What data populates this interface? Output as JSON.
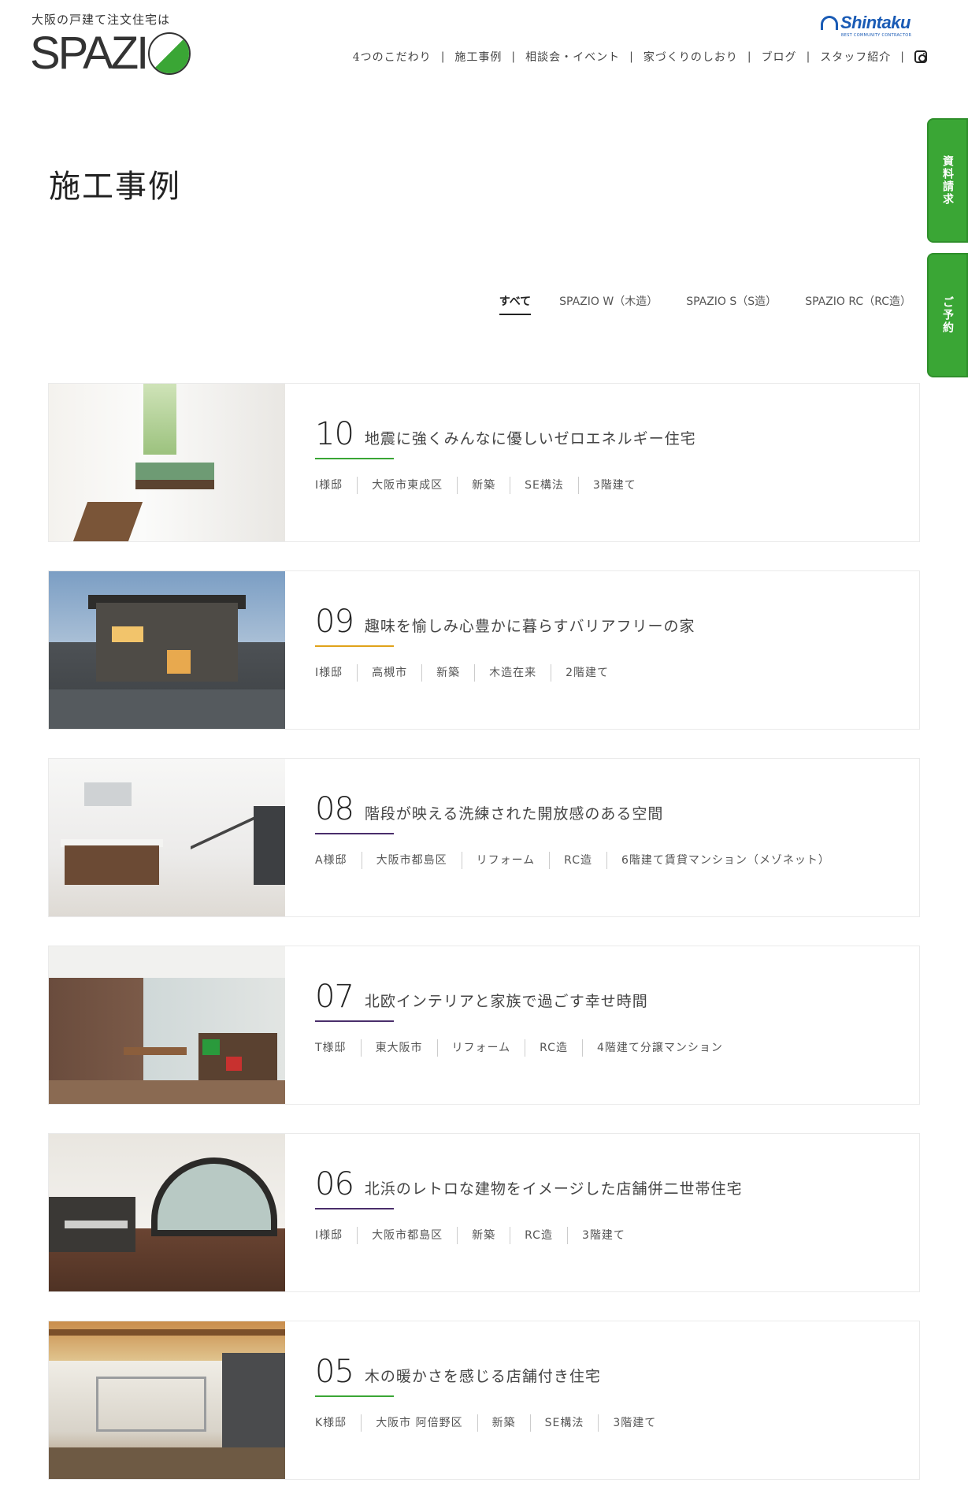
{
  "header": {
    "tagline": "大阪の戸建て注文住宅は",
    "logo_text": "SPAZI",
    "brand_name": "Shintaku",
    "brand_sub": "BEST COMMUNITY CONTRACTOR",
    "nav": [
      {
        "label": "4つのこだわり"
      },
      {
        "label": "施工事例"
      },
      {
        "label": "相談会・イベント"
      },
      {
        "label": "家づくりのしおり"
      },
      {
        "label": "ブログ"
      },
      {
        "label": "スタッフ紹介"
      }
    ],
    "separator": "|",
    "instagram_icon": "instagram-icon"
  },
  "side_tabs": {
    "request": "資料請求",
    "reserve": "ご予約"
  },
  "page_title": "施工事例",
  "filters": [
    {
      "label": "すべて",
      "active": true
    },
    {
      "label": "SPAZIO W（木造）",
      "active": false
    },
    {
      "label": "SPAZIO S（S造）",
      "active": false
    },
    {
      "label": "SPAZIO RC（RC造）",
      "active": false
    }
  ],
  "works": [
    {
      "num": "10",
      "title": "地震に強くみんなに優しいゼロエネルギー住宅",
      "rule_color": "#3aa635",
      "tags": [
        "I様邸",
        "大阪市東成区",
        "新築",
        "SE構法",
        "3階建て"
      ]
    },
    {
      "num": "09",
      "title": "趣味を愉しみ心豊かに暮らすバリアフリーの家",
      "rule_color": "#e0a21a",
      "tags": [
        "I様邸",
        "高槻市",
        "新築",
        "木造在来",
        "2階建て"
      ]
    },
    {
      "num": "08",
      "title": "階段が映える洗練された開放感のある空間",
      "rule_color": "#4a2e6b",
      "tags": [
        "A様邸",
        "大阪市都島区",
        "リフォーム",
        "RC造",
        "6階建て賃貸マンション（メゾネット）"
      ]
    },
    {
      "num": "07",
      "title": "北欧インテリアと家族で過ごす幸せ時間",
      "rule_color": "#4a2e6b",
      "tags": [
        "T様邸",
        "東大阪市",
        "リフォーム",
        "RC造",
        "4階建て分譲マンション"
      ]
    },
    {
      "num": "06",
      "title": "北浜のレトロな建物をイメージした店舗併二世帯住宅",
      "rule_color": "#4a2e6b",
      "tags": [
        "I様邸",
        "大阪市都島区",
        "新築",
        "RC造",
        "3階建て"
      ]
    },
    {
      "num": "05",
      "title": "木の暖かさを感じる店舗付き住宅",
      "rule_color": "#3aa635",
      "tags": [
        "K様邸",
        "大阪市 阿倍野区",
        "新築",
        "SE構法",
        "3階建て"
      ]
    }
  ]
}
